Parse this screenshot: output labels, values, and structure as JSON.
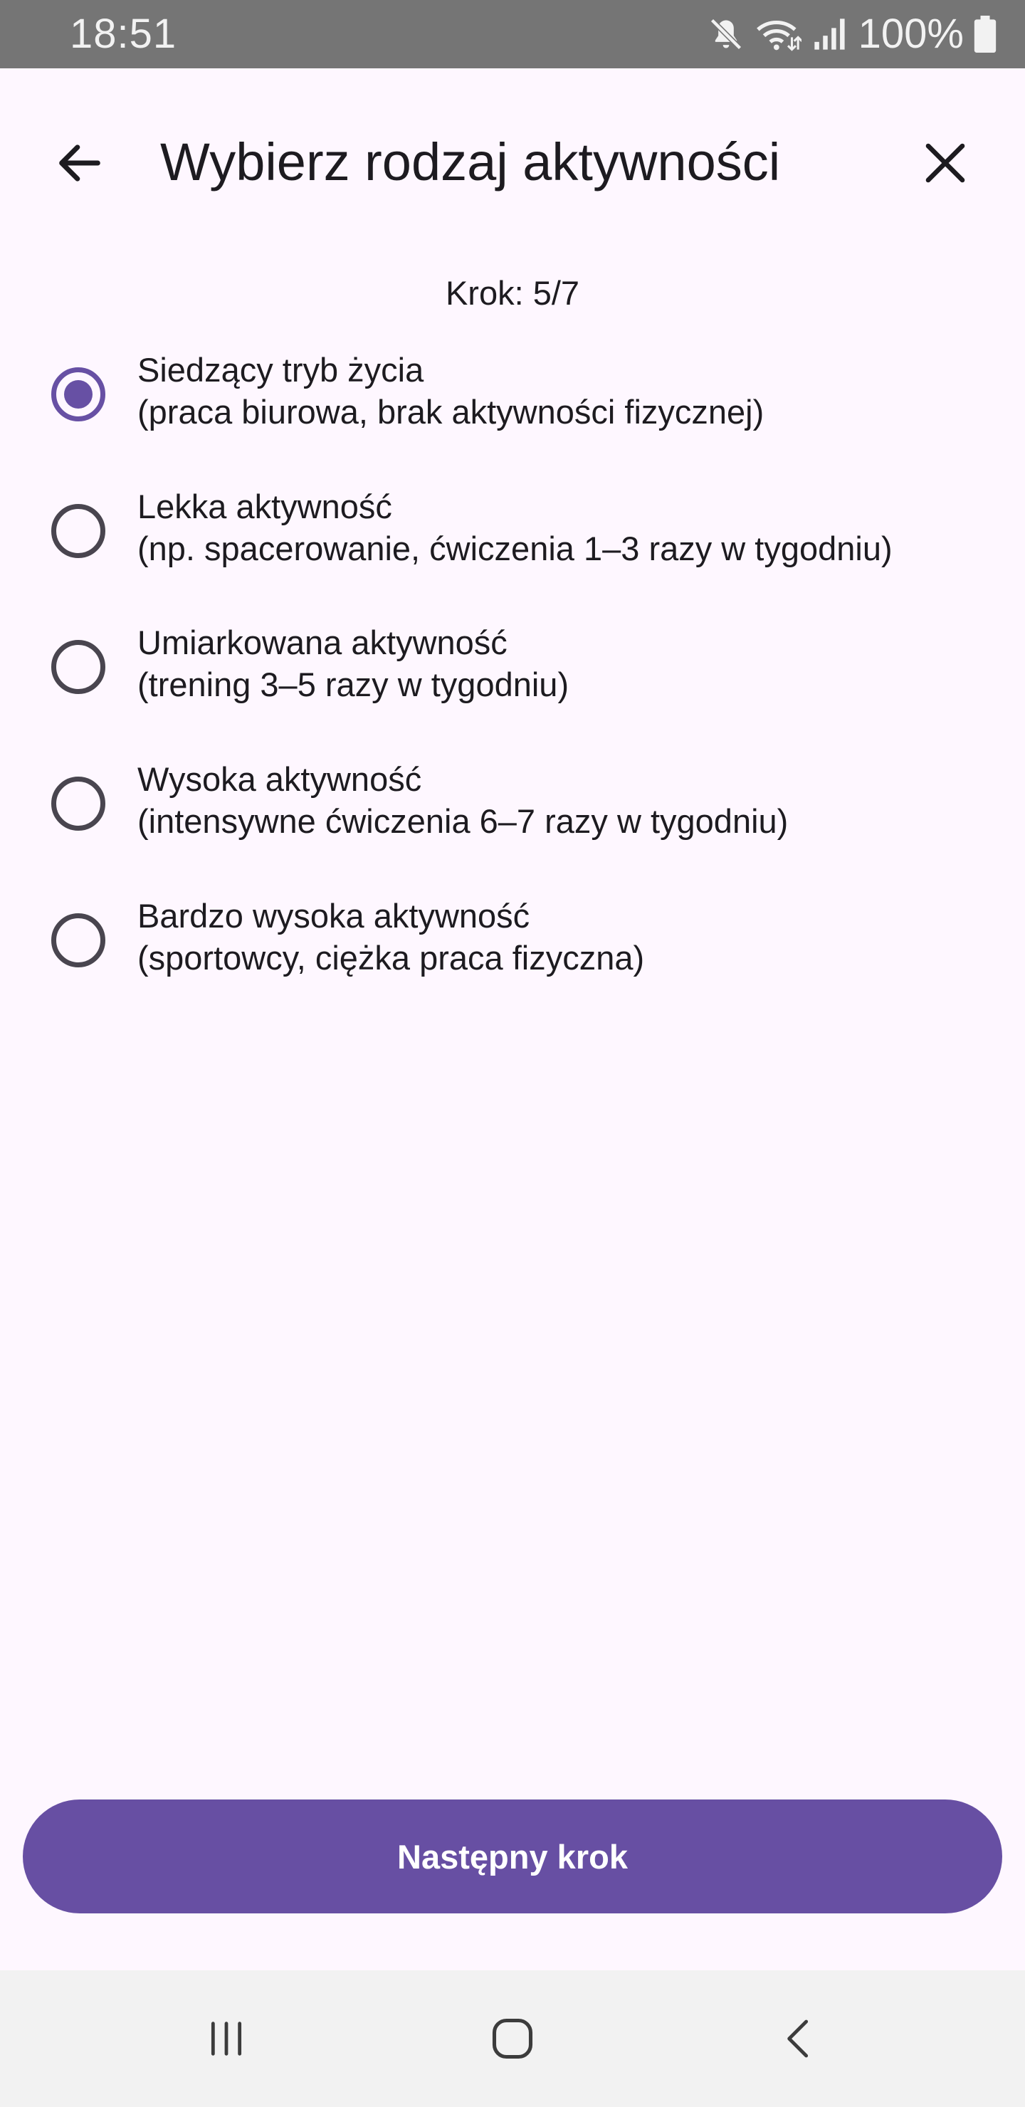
{
  "status_bar": {
    "time": "18:51",
    "battery_text": "100%",
    "icons": [
      "mute-icon",
      "wifi-icon",
      "signal-icon",
      "battery-icon"
    ]
  },
  "app_bar": {
    "title": "Wybierz rodzaj aktywności",
    "back_icon": "arrow-left-icon",
    "close_icon": "close-icon"
  },
  "step": {
    "label": "Krok: 5/7"
  },
  "options": [
    {
      "title": "Siedzący tryb życia",
      "description": "(praca biurowa, brak aktywności fizycznej)",
      "selected": true
    },
    {
      "title": "Lekka aktywność",
      "description": "(np. spacerowanie, ćwiczenia 1–3 razy w tygodniu)",
      "selected": false
    },
    {
      "title": "Umiarkowana aktywność",
      "description": "(trening 3–5 razy w tygodniu)",
      "selected": false
    },
    {
      "title": "Wysoka aktywność",
      "description": "(intensywne ćwiczenia 6–7 razy w tygodniu)",
      "selected": false
    },
    {
      "title": "Bardzo wysoka aktywność",
      "description": "(sportowcy, ciężka praca fizyczna)",
      "selected": false
    }
  ],
  "next_button": {
    "label": "Następny krok"
  },
  "nav_bar": {
    "icons": [
      "recent-apps-icon",
      "home-icon",
      "back-icon"
    ]
  },
  "colors": {
    "background": "#FEF7FF",
    "accent": "#674FA3",
    "status_bar": "#757575",
    "nav_bar": "#F2F2F2",
    "text": "#1D1B20",
    "radio_unselected": "#49454F"
  }
}
